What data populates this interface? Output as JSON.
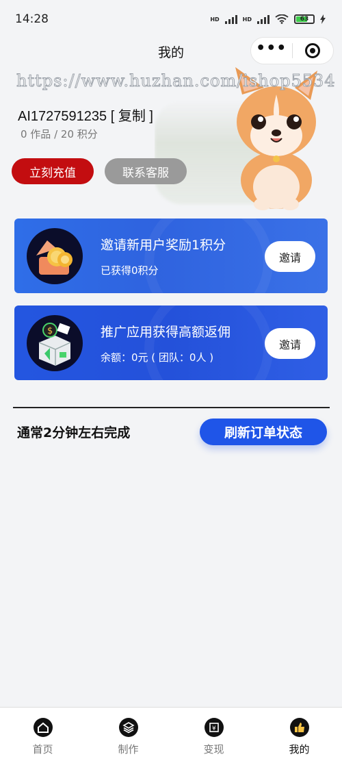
{
  "status_bar": {
    "time": "14:28",
    "signal_1_label": "HD",
    "signal_2_label": "HD",
    "battery": "63"
  },
  "nav": {
    "title": "我的",
    "more_icon": "more-dots-icon",
    "close_icon": "target-icon"
  },
  "watermark": "https://www.huzhan.com/ishop5534",
  "profile": {
    "user_id": "AI1727591235",
    "copy_label": "[ 复制 ]",
    "stats": "0 作品 / 20 积分"
  },
  "actions": {
    "recharge_label": "立刻充值",
    "service_label": "联系客服"
  },
  "cards": [
    {
      "title": "邀请新用户奖励1积分",
      "subtitle": "已获得0积分",
      "button": "邀请",
      "icon": "gift-coins-icon"
    },
    {
      "title": "推广应用获得高额返佣",
      "subtitle": "余额：0元 ( 团队：0人 )",
      "button": "邀请",
      "icon": "money-box-icon"
    }
  ],
  "order": {
    "notice": "通常2分钟左右完成",
    "refresh_label": "刷新订单状态"
  },
  "tabbar": {
    "items": [
      {
        "label": "首页",
        "icon": "home-icon"
      },
      {
        "label": "制作",
        "icon": "layers-icon"
      },
      {
        "label": "变现",
        "icon": "money-icon"
      },
      {
        "label": "我的",
        "icon": "thumbs-up-icon"
      }
    ],
    "active_index": 3
  },
  "colors": {
    "recharge": "#c30d10",
    "service": "#9a9a9a",
    "card_blue": "#2f63df",
    "refresh_blue": "#1f55e8"
  }
}
